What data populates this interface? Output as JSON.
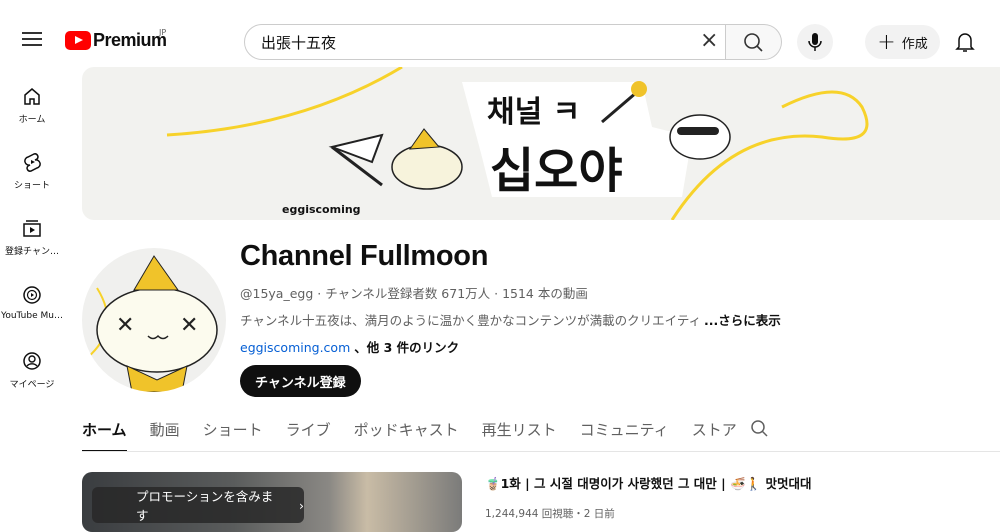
{
  "header": {
    "logo_text": "Premium",
    "region": "JP",
    "search_value": "出張十五夜",
    "create_label": "作成"
  },
  "sidebar": {
    "items": [
      {
        "label": "ホーム",
        "icon": "home-icon"
      },
      {
        "label": "ショート",
        "icon": "shorts-icon"
      },
      {
        "label": "登録チャン…",
        "icon": "subscriptions-icon"
      },
      {
        "label": "YouTube Mu…",
        "icon": "youtube-music-icon"
      },
      {
        "label": "マイページ",
        "icon": "account-icon"
      }
    ]
  },
  "banner": {
    "logo_korean": "채널 십오야",
    "brand": "eggiscoming"
  },
  "channel": {
    "name": "Channel Fullmoon",
    "handle": "@15ya_egg",
    "meta": "@15ya_egg · チャンネル登録者数 671万人 · 1514 本の動画",
    "description": "チャンネル十五夜は、満月のように温かく豊かなコンテンツが満載のクリエイティ",
    "more": "...さらに表示",
    "link": "eggiscoming.com",
    "link_more": "、他 3 件のリンク",
    "subscribe": "チャンネル登録"
  },
  "tabs": [
    {
      "label": "ホーム",
      "active": true
    },
    {
      "label": "動画"
    },
    {
      "label": "ショート"
    },
    {
      "label": "ライブ"
    },
    {
      "label": "ポッドキャスト"
    },
    {
      "label": "再生リスト"
    },
    {
      "label": "コミュニティ"
    },
    {
      "label": "ストア"
    }
  ],
  "featured": {
    "promo": "プロモーションを含みます",
    "title": "🧋1화 | 그 시절 대명이가 사랑했던 그 대만 | 🍜🚶 맛멋대대",
    "views": "1,244,944 回視聴",
    "age": "2 日前",
    "meta": "1,244,944 回視聴・2 日前"
  },
  "colors": {
    "brand_red": "#ff0000",
    "accent_yellow": "#f7d22a",
    "link": "#065fd4"
  }
}
